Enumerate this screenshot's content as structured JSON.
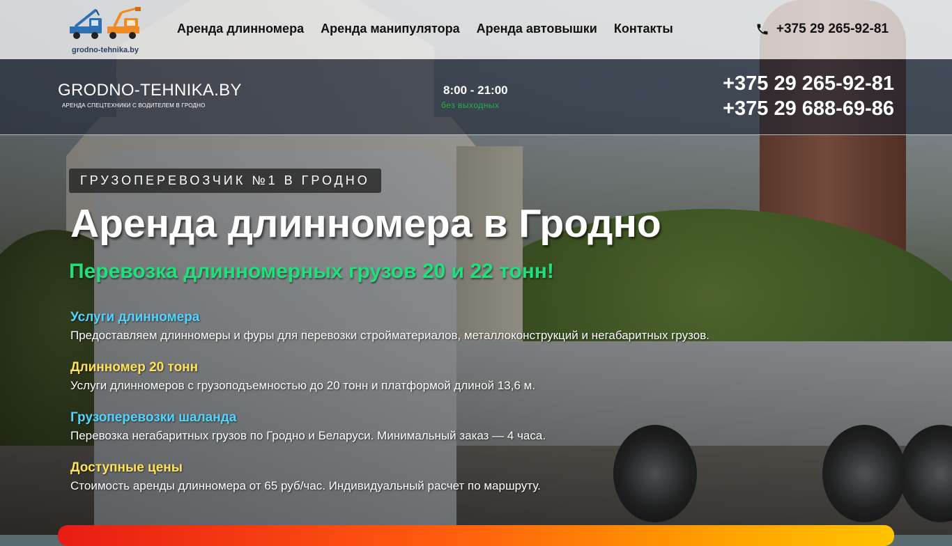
{
  "nav": {
    "logo_text": "grodno-tehnika.by",
    "menu": [
      {
        "label": "Аренда длинномера"
      },
      {
        "label": "Аренда манипулятора"
      },
      {
        "label": "Аренда автовышки"
      },
      {
        "label": "Контакты"
      }
    ],
    "phone": "+375 29 265-92-81"
  },
  "infobar": {
    "brand_title": "GRODNO-TEHNIKA.BY",
    "brand_subtitle": "АРЕНДА СПЕЦТЕХНИКИ С ВОДИТЕЛЕМ В ГРОДНО",
    "hours": "8:00 - 21:00",
    "hours_note": "без выходных",
    "phones": [
      "+375 29 265-92-81",
      "+375 29 688-69-86"
    ]
  },
  "hero": {
    "badge": "ГРУЗОПЕРЕВОЗЧИК №1 В ГРОДНО",
    "title": "Аренда длинномера в Гродно",
    "subtitle": "Перевозка длинномерных грузов 20 и 22 тонн!",
    "features": [
      {
        "title": "Услуги длинномера",
        "text": "Предоставляем длинномеры и фуры для перевозки стройматериалов, металлоконструкций и негабаритных грузов.",
        "color": "#52d4ff"
      },
      {
        "title": "Длинномер 20 тонн",
        "text": "Услуги длинномеров с грузоподъемностью до 20 тонн и платформой длиной 13,6 м.",
        "color": "#ffe15a"
      },
      {
        "title": "Грузоперевозки шаланда",
        "text": "Перевозка негабаритных грузов по Гродно и Беларуси. Минимальный заказ — 4 часа.",
        "color": "#52d4ff"
      },
      {
        "title": "Доступные цены",
        "text": "Стоимость аренды длинномера от 65 руб/час. Индивидуальный расчет по маршруту.",
        "color": "#ffe15a"
      }
    ]
  },
  "colors": {
    "accent_green": "#1fe07a",
    "hours_note_green": "#1fb24a",
    "cta_gradient_start": "#e81c14",
    "cta_gradient_end": "#ffc300"
  }
}
